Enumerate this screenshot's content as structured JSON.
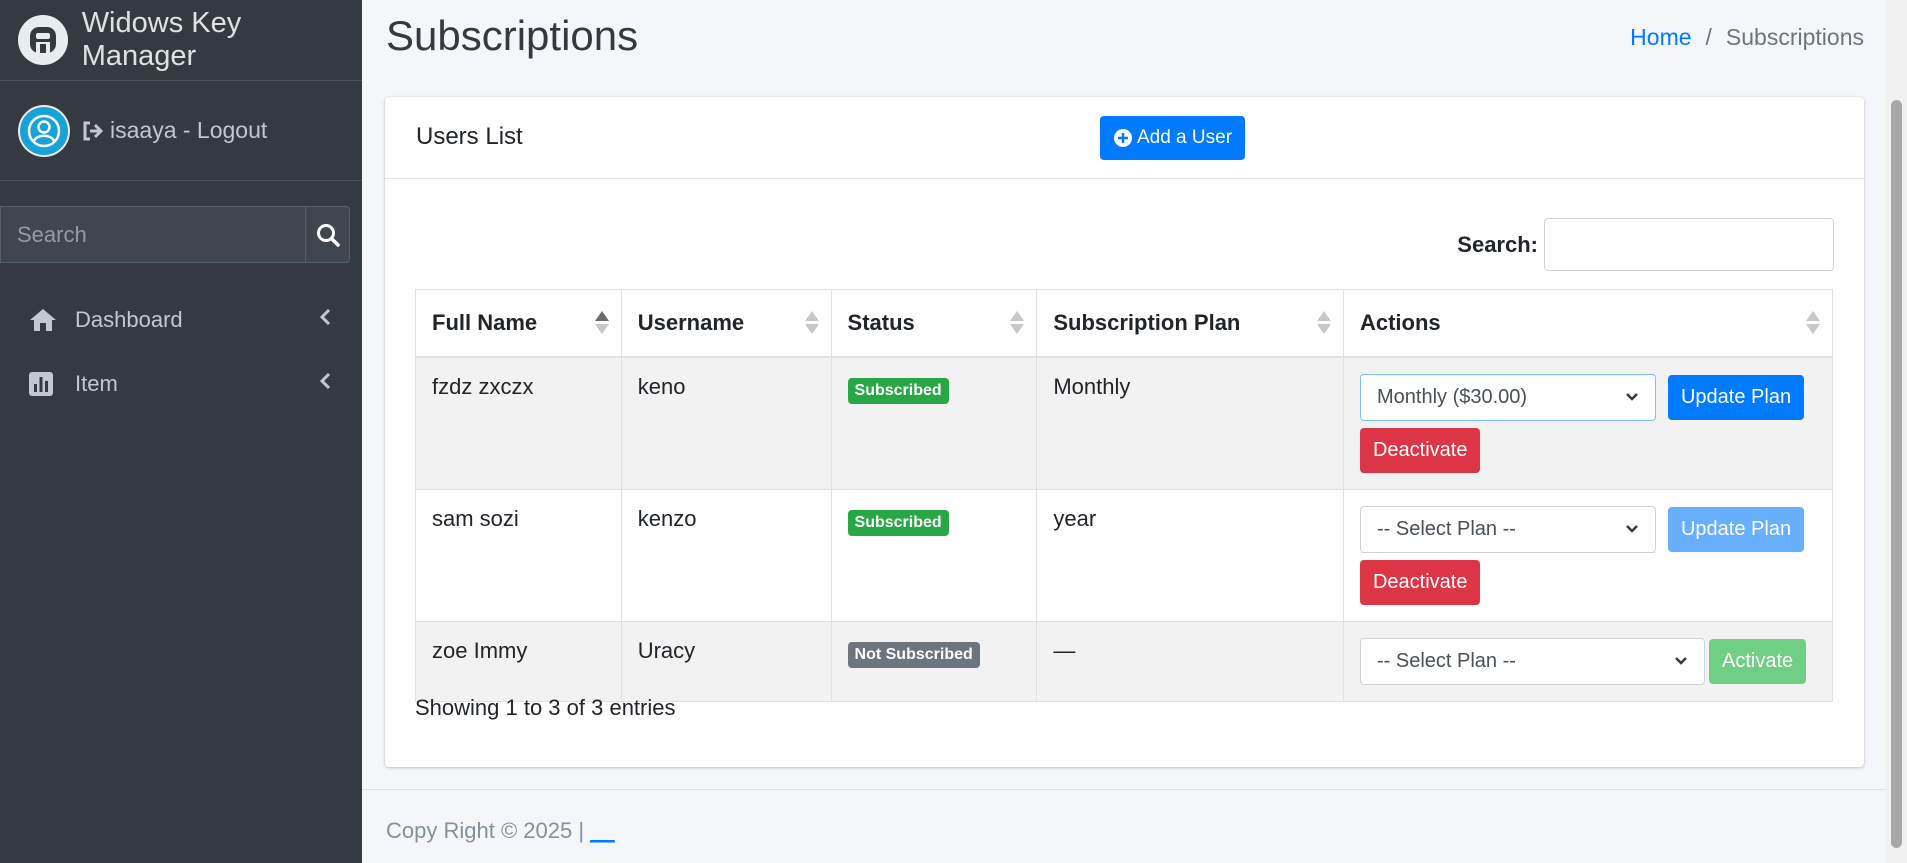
{
  "sidebar": {
    "brand": "Widows Key Manager",
    "user_link": "isaaya - Logout",
    "search_placeholder": "Search",
    "nav": [
      {
        "label": "Dashboard",
        "icon": "home-icon"
      },
      {
        "label": "Item",
        "icon": "chart-icon"
      }
    ]
  },
  "header": {
    "title": "Subscriptions",
    "breadcrumb": {
      "home": "Home",
      "separator": "/",
      "current": "Subscriptions"
    }
  },
  "card": {
    "title": "Users List",
    "add_button": "Add a User",
    "search_label": "Search:",
    "search_value": "",
    "columns": [
      "Full Name",
      "Username",
      "Status",
      "Subscription Plan",
      "Actions"
    ],
    "rows": [
      {
        "full_name": "fzdz zxczx",
        "username": "keno",
        "status": "Subscribed",
        "plan": "Monthly",
        "select": "Monthly ($30.00)",
        "action1": "Update Plan",
        "action2": "Deactivate"
      },
      {
        "full_name": "sam sozi",
        "username": "kenzo",
        "status": "Subscribed",
        "plan": "year",
        "select": "-- Select Plan --",
        "action1": "Update Plan",
        "action2": "Deactivate"
      },
      {
        "full_name": "zoe Immy",
        "username": "Uracy",
        "status": "Not Subscribed",
        "plan": "—",
        "select": "-- Select Plan --",
        "action1": "Activate"
      }
    ],
    "info": "Showing 1 to 3 of 3 entries"
  },
  "footer": {
    "text": "Copy Right © 2025 |",
    "link": "__"
  },
  "colors": {
    "primary": "#007bff",
    "success": "#28a745",
    "danger": "#dc3545",
    "secondary": "#6c757d",
    "sidebar": "#343a40"
  }
}
